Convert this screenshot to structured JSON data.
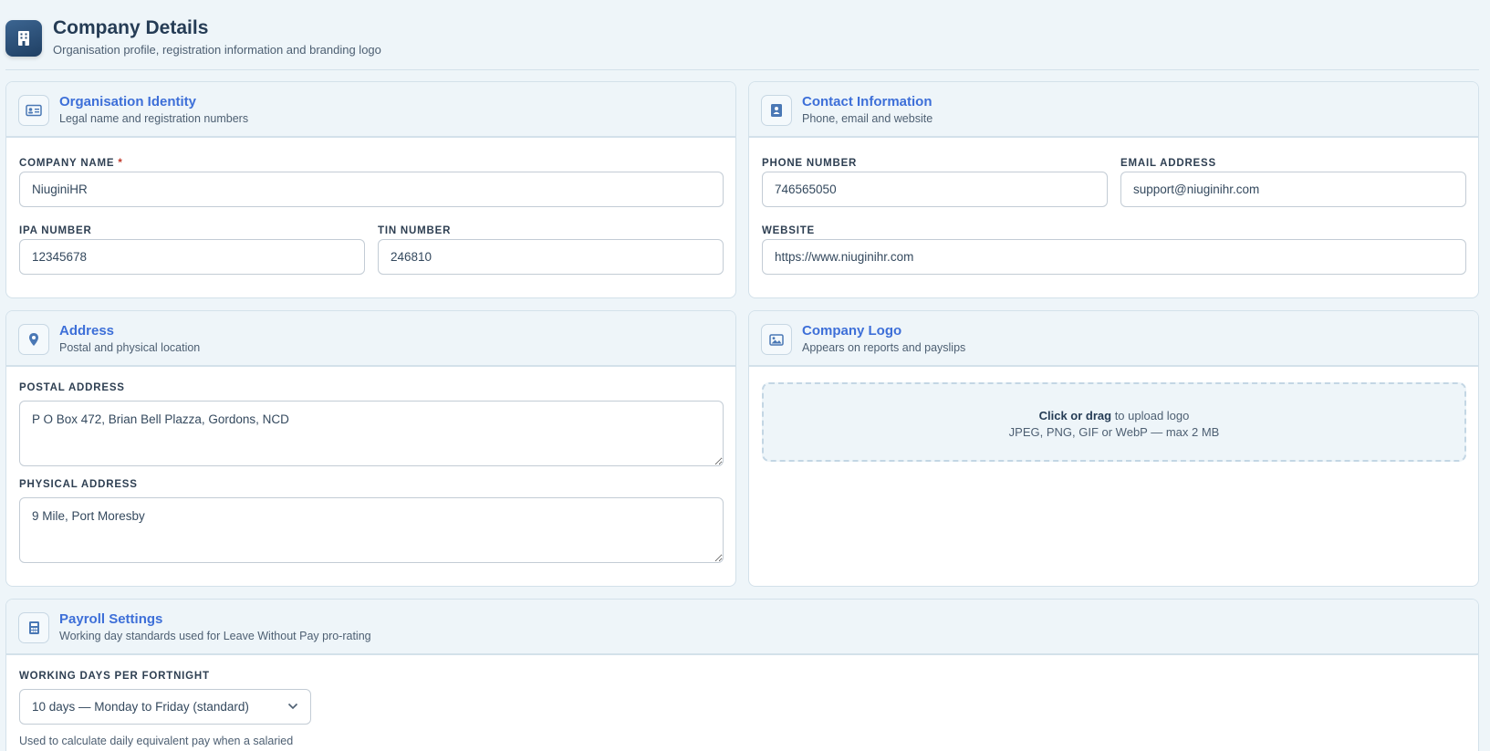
{
  "header": {
    "title": "Company Details",
    "subtitle": "Organisation profile, registration information and branding logo",
    "icon": "building-icon"
  },
  "identity": {
    "title": "Organisation Identity",
    "subtitle": "Legal name and registration numbers",
    "icon": "id-card-icon",
    "company_name_label": "Company Name",
    "company_name_required": "*",
    "company_name_value": "NiuginiHR",
    "ipa_label": "IPA Number",
    "ipa_value": "12345678",
    "tin_label": "TIN Number",
    "tin_value": "246810"
  },
  "contact": {
    "title": "Contact Information",
    "subtitle": "Phone, email and website",
    "icon": "contact-book-icon",
    "phone_label": "Phone Number",
    "phone_value": "746565050",
    "email_label": "Email Address",
    "email_value": "support@niuginihr.com",
    "website_label": "Website",
    "website_value": "https://www.niuginihr.com"
  },
  "address": {
    "title": "Address",
    "subtitle": "Postal and physical location",
    "icon": "map-pin-icon",
    "postal_label": "Postal Address",
    "postal_value": "P O Box 472, Brian Bell Plazza, Gordons, NCD",
    "physical_label": "Physical Address",
    "physical_value": "9 Mile, Port Moresby"
  },
  "logo": {
    "title": "Company Logo",
    "subtitle": "Appears on reports and payslips",
    "icon": "image-icon",
    "upload_strong": "Click or drag",
    "upload_rest": " to upload logo",
    "upload_hint": "JPEG, PNG, GIF or WebP — max 2 MB"
  },
  "payroll": {
    "title": "Payroll Settings",
    "subtitle": "Working day standards used for Leave Without Pay pro-rating",
    "icon": "calculator-icon",
    "days_label": "Working Days Per Fortnight",
    "days_selected": "10 days — Monday to Friday (standard)",
    "helper": "Used to calculate daily equivalent pay when a salaried employee's entitlement is deducted for Leave Without Pay days."
  },
  "colors": {
    "accent": "#3d6fd8",
    "required": "#c0392b",
    "page_bg": "#eef5f9"
  }
}
